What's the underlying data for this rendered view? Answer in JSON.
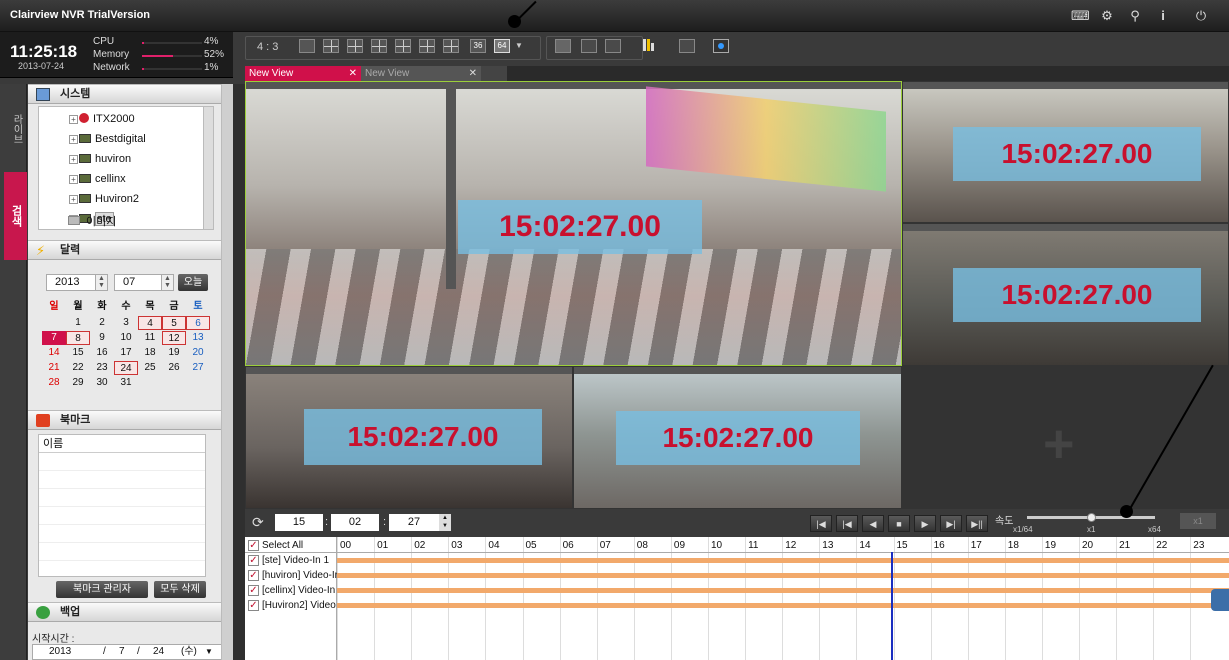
{
  "app": {
    "title": "Clairview NVR TrialVersion"
  },
  "status": {
    "time": "11:25:18",
    "date": "2013-07-24",
    "metrics": [
      {
        "label": "CPU",
        "value": "4%",
        "level": 0.04
      },
      {
        "label": "Memory",
        "value": "52%",
        "level": 0.52
      },
      {
        "label": "Network",
        "value": "1%",
        "level": 0.01
      }
    ]
  },
  "left_tabs": {
    "live": "라이브",
    "search": "검색"
  },
  "system_panel": {
    "title": "시스템",
    "items": [
      "ITX2000",
      "Bestdigital",
      "huviron",
      "cellinx",
      "Huviron2",
      "ste"
    ],
    "image_label": "이미지"
  },
  "calendar": {
    "title": "달력",
    "year": "2013",
    "month": "07",
    "today_label": "오늘",
    "weekdays": [
      "일",
      "월",
      "화",
      "수",
      "목",
      "금",
      "토"
    ],
    "weeks": [
      [
        "",
        "1",
        "2",
        "3",
        "4",
        "5",
        "6"
      ],
      [
        "7",
        "8",
        "9",
        "10",
        "11",
        "12",
        "13"
      ],
      [
        "14",
        "15",
        "16",
        "17",
        "18",
        "19",
        "20"
      ],
      [
        "21",
        "22",
        "23",
        "24",
        "25",
        "26",
        "27"
      ],
      [
        "28",
        "29",
        "30",
        "31",
        "",
        "",
        ""
      ]
    ]
  },
  "bookmark": {
    "title": "북마크",
    "column": "이름",
    "manage_label": "북마크 관리자",
    "delete_all_label": "모두 삭제"
  },
  "backup": {
    "title": "백업",
    "start_time_label": "시작시간 :",
    "start_year": "2013",
    "start_month": "7",
    "start_day": "24",
    "start_weekday": "(수)"
  },
  "toolbar": {
    "ratio": "4 : 3",
    "split_36": "36",
    "split_64": "64"
  },
  "view_tabs": [
    {
      "label": "New View",
      "active": true
    },
    {
      "label": "New View",
      "active": false
    }
  ],
  "video": {
    "timestamp": "15:02:27.00"
  },
  "playback": {
    "hour": "15",
    "minute": "02",
    "second": "27",
    "speed_label": "속도",
    "speed_min": "x1/64",
    "speed_mid": "x1",
    "speed_max": "x64",
    "speed_value": "x1"
  },
  "timeline": {
    "select_all": "Select All",
    "hours": [
      "00",
      "01",
      "02",
      "03",
      "04",
      "05",
      "06",
      "07",
      "08",
      "09",
      "10",
      "11",
      "12",
      "13",
      "14",
      "15",
      "16",
      "17",
      "18",
      "19",
      "20",
      "21",
      "22",
      "23"
    ],
    "channels": [
      "[ste] Video-In 1",
      "[huviron] Video-Ir",
      "[cellinx] Video-In",
      "[Huviron2] Video"
    ]
  }
}
